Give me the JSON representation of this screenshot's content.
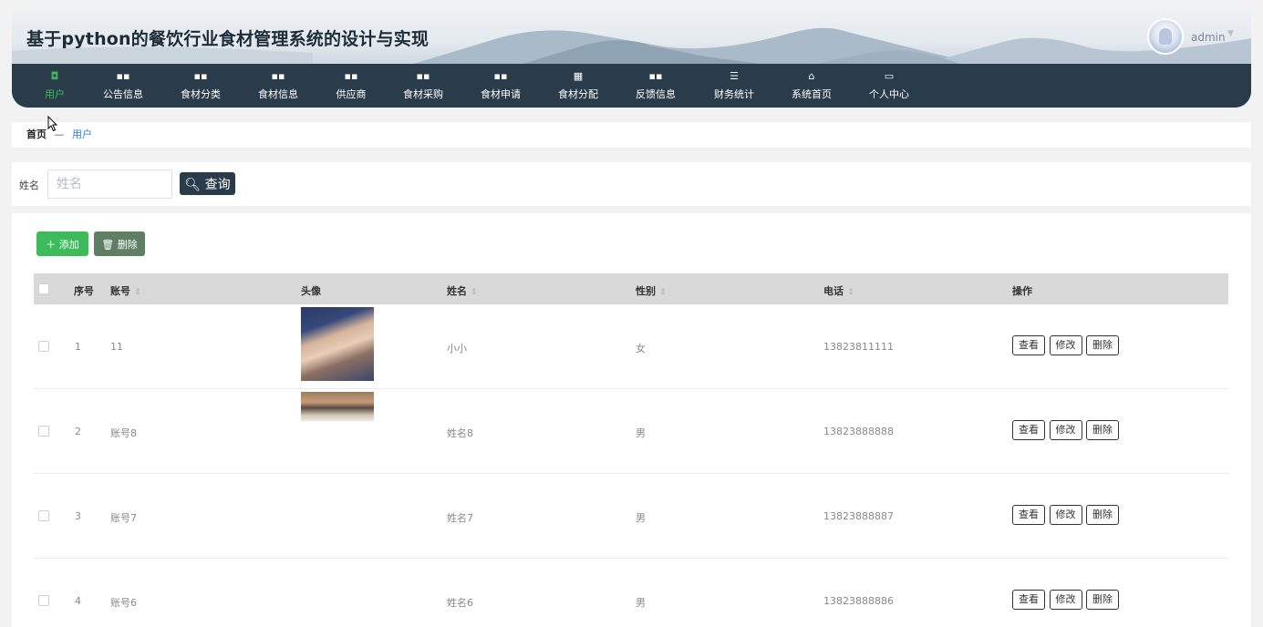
{
  "header": {
    "title": "基于python的餐饮行业食材管理系统的设计与实现",
    "username": "admin"
  },
  "nav": [
    {
      "label": "用户",
      "icon": "clipboard-icon",
      "glyph": "◘",
      "active": true
    },
    {
      "label": "公告信息",
      "icon": "grid-icon",
      "glyph": "▪▪"
    },
    {
      "label": "食材分类",
      "icon": "grid-icon",
      "glyph": "▪▪"
    },
    {
      "label": "食材信息",
      "icon": "grid-icon",
      "glyph": "▪▪"
    },
    {
      "label": "供应商",
      "icon": "grid-icon",
      "glyph": "▪▪"
    },
    {
      "label": "食材采购",
      "icon": "grid-icon",
      "glyph": "▪▪"
    },
    {
      "label": "食材申请",
      "icon": "grid-icon",
      "glyph": "▪▪"
    },
    {
      "label": "食材分配",
      "icon": "grid-icon",
      "glyph": "▦"
    },
    {
      "label": "反馈信息",
      "icon": "grid-icon",
      "glyph": "▪▪"
    },
    {
      "label": "财务统计",
      "icon": "sliders-icon",
      "glyph": "☰"
    },
    {
      "label": "系统首页",
      "icon": "home-icon",
      "glyph": "⌂"
    },
    {
      "label": "个人中心",
      "icon": "card-icon",
      "glyph": "▭"
    }
  ],
  "breadcrumb": {
    "home": "首页",
    "separator": "—",
    "current": "用户"
  },
  "search": {
    "label": "姓名",
    "placeholder": "姓名",
    "button": "查询"
  },
  "toolbar": {
    "add": "添加",
    "delete": "删除"
  },
  "table": {
    "headers": {
      "index": "序号",
      "account": "账号",
      "avatar": "头像",
      "name": "姓名",
      "gender": "性别",
      "phone": "电话",
      "actions": "操作"
    },
    "rows": [
      {
        "index": "1",
        "account": "11",
        "name": "小小",
        "gender": "女",
        "phone": "13823811111"
      },
      {
        "index": "2",
        "account": "账号8",
        "name": "姓名8",
        "gender": "男",
        "phone": "13823888888"
      },
      {
        "index": "3",
        "account": "账号7",
        "name": "姓名7",
        "gender": "男",
        "phone": "13823888887"
      },
      {
        "index": "4",
        "account": "账号6",
        "name": "姓名6",
        "gender": "男",
        "phone": "13823888886"
      }
    ],
    "row_actions": {
      "view": "查看",
      "edit": "修改",
      "delete": "删除"
    }
  },
  "colors": {
    "nav_bg": "#2a3b4a",
    "accent": "#3dbb5c",
    "delete_btn": "#5e7f63",
    "link": "#2d7ed3"
  }
}
